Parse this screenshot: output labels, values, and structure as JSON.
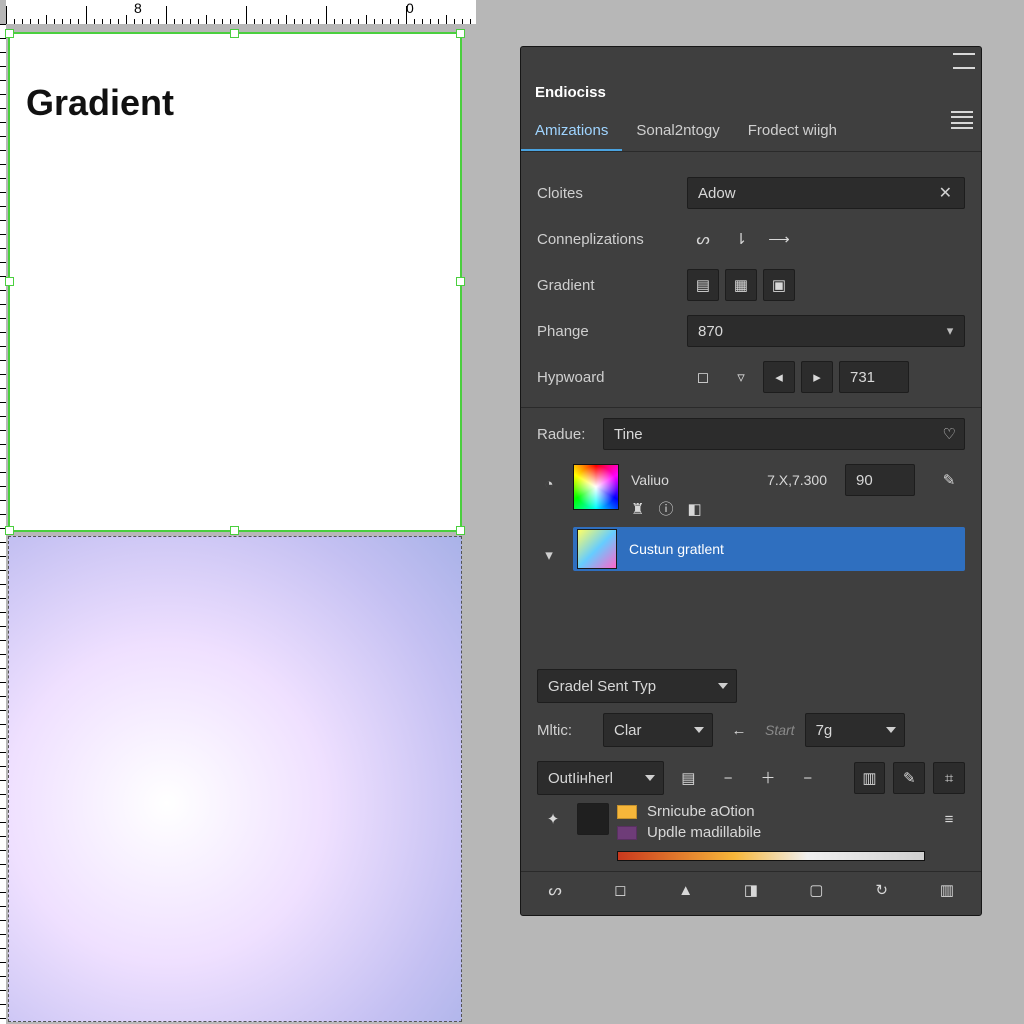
{
  "ruler": {
    "mark_a": "8",
    "mark_b": "0"
  },
  "artboard": {
    "title": "Gradient"
  },
  "panel": {
    "title_tab": "Endiociss",
    "tabs": [
      "Amizations",
      "Sonal2ntogy",
      "Frodect wiigh"
    ],
    "active_tab_index": 0,
    "rows": {
      "cloites": {
        "label": "Cloites",
        "value": "Adow"
      },
      "connep": {
        "label": "Conneplizations"
      },
      "gradient": {
        "label": "Gradient"
      },
      "phange": {
        "label": "Phange",
        "value": "870"
      },
      "hypwoard": {
        "label": "Hypwoard",
        "value": "731"
      },
      "radue": {
        "label": "Radue:",
        "value": "Tine"
      }
    },
    "value_block": {
      "title": "Valiuo",
      "coords": "7.X,7.300",
      "angle": "90"
    },
    "list_item": {
      "label": "Custun gratlent"
    },
    "send_type": {
      "label": "Gradel Sent Typ"
    },
    "mitic": {
      "label": "Mltic:",
      "value": "Clar",
      "start_label": "Start",
      "start_value": "7g"
    },
    "out_inherit": {
      "value": "OutIінherl"
    },
    "legend": {
      "a": "Srnicube aOtion",
      "b": "Updle madillabile"
    }
  }
}
